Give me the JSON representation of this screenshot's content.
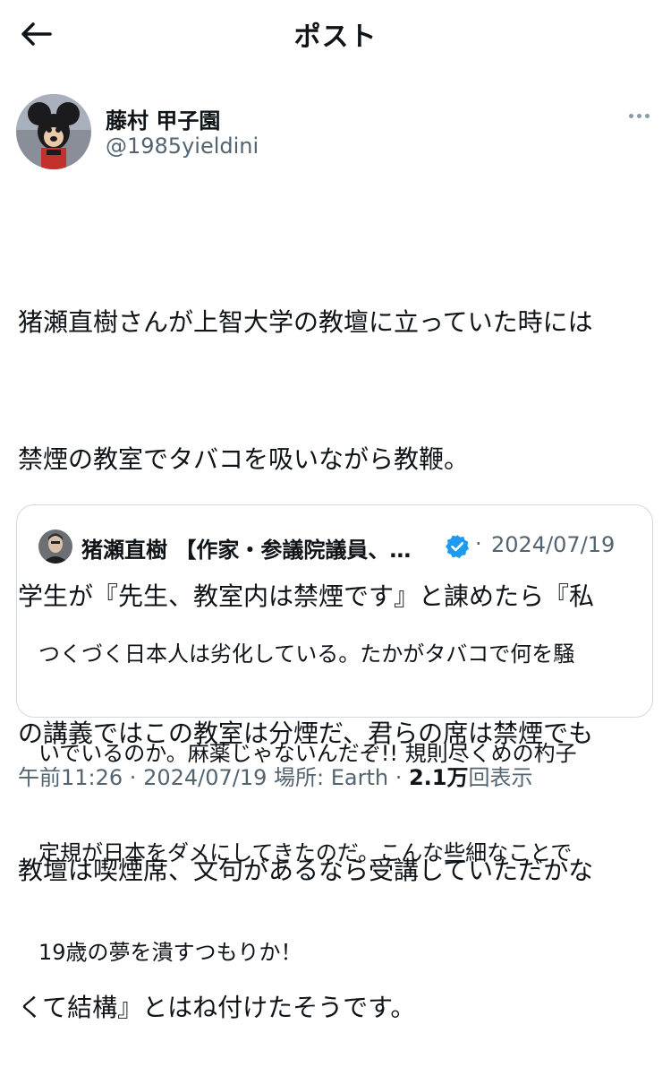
{
  "header": {
    "title": "ポスト"
  },
  "author": {
    "name": "藤村 甲子園",
    "handle": "@1985yieldini"
  },
  "post": {
    "lines": [
      "猪瀬直樹さんが上智大学の教壇に立っていた時には",
      "禁煙の教室でタバコを吸いながら教鞭。",
      "学生が『先生、教室内は禁煙です』と諌めたら『私",
      "の講義ではこの教室は分煙だ、君らの席は禁煙でも",
      "教壇は喫煙席、文句があるなら受講していただかな",
      "くて結構』とはね付けたそうです。"
    ]
  },
  "quote": {
    "name": "猪瀬直樹 【作家・参議院議員、…",
    "date": "2024/07/19",
    "separator": "·",
    "lines": [
      "つくづく日本人は劣化している。たかがタバコで何を騒",
      "いでいるのか。麻薬じゃないんだぞ!! 規則尽くめの杓子",
      "定規が日本をダメにしてきたのだ。こんな些細なことで",
      "19歳の夢を潰すつもりか！"
    ]
  },
  "meta": {
    "time": "午前11:26",
    "sep1": " · ",
    "date": "2024/07/19",
    "location": " 場所: Earth",
    "sep2": " · ",
    "views_count": "2.1万",
    "views_label": "回表示"
  },
  "colors": {
    "text": "#0f1419",
    "secondary": "#536471",
    "verified": "#1d9bf0",
    "border": "#cfd9de"
  },
  "icons": {
    "back": "arrow-left-icon",
    "more": "more-horizontal-icon",
    "verified": "verified-badge-icon"
  }
}
